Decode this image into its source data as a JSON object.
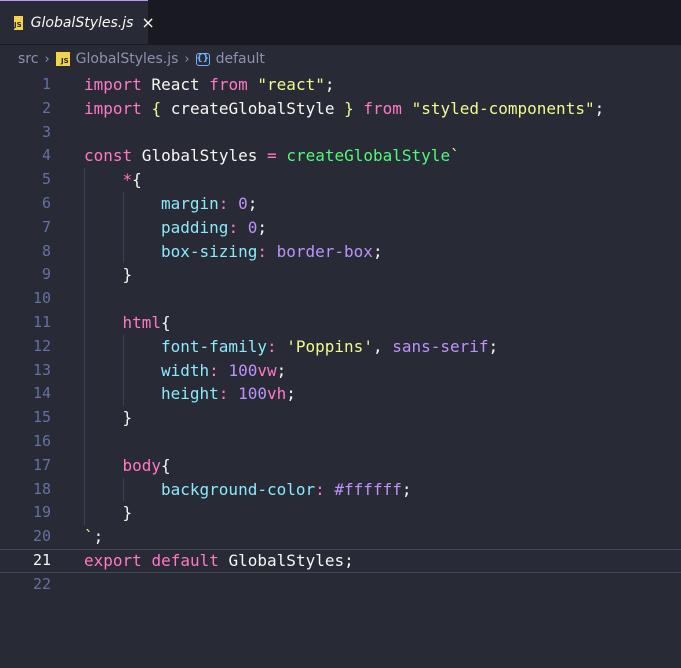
{
  "tab": {
    "title": "GlobalStyles.js",
    "icon": "js-file-icon",
    "close": "×"
  },
  "breadcrumb": {
    "folder": "src",
    "file": "GlobalStyles.js",
    "symbol": "default"
  },
  "colors": {
    "background": "#282a36",
    "tabbar": "#191a21",
    "keyword": "#ff79c6",
    "string": "#f1fa8c",
    "function": "#50fa7b",
    "property": "#8be9fd",
    "number": "#bd93f9"
  },
  "editor": {
    "active_line": 21,
    "lines": [
      {
        "n": "1",
        "indent": 0,
        "tokens": [
          [
            "kw",
            "import"
          ],
          [
            "plain",
            " React "
          ],
          [
            "kw",
            "from"
          ],
          [
            "plain",
            " "
          ],
          [
            "str",
            "\"react\""
          ],
          [
            "plain",
            ";"
          ]
        ]
      },
      {
        "n": "2",
        "indent": 0,
        "tokens": [
          [
            "kw",
            "import"
          ],
          [
            "plain",
            " "
          ],
          [
            "brace",
            "{"
          ],
          [
            "plain",
            " createGlobalStyle "
          ],
          [
            "brace",
            "}"
          ],
          [
            "plain",
            " "
          ],
          [
            "kw",
            "from"
          ],
          [
            "plain",
            " "
          ],
          [
            "str",
            "\"styled-components\""
          ],
          [
            "plain",
            ";"
          ]
        ]
      },
      {
        "n": "3",
        "indent": 0,
        "tokens": []
      },
      {
        "n": "4",
        "indent": 0,
        "tokens": [
          [
            "kw",
            "const"
          ],
          [
            "plain",
            " GlobalStyles "
          ],
          [
            "op",
            "="
          ],
          [
            "plain",
            " "
          ],
          [
            "fn",
            "createGlobalStyle"
          ],
          [
            "str",
            "`"
          ]
        ]
      },
      {
        "n": "5",
        "indent": 1,
        "tokens": [
          [
            "tag",
            "*"
          ],
          [
            "plain",
            "{"
          ]
        ]
      },
      {
        "n": "6",
        "indent": 2,
        "tokens": [
          [
            "prop",
            "margin"
          ],
          [
            "op",
            ":"
          ],
          [
            "plain",
            " "
          ],
          [
            "num",
            "0"
          ],
          [
            "plain",
            ";"
          ]
        ]
      },
      {
        "n": "7",
        "indent": 2,
        "tokens": [
          [
            "prop",
            "padding"
          ],
          [
            "op",
            ":"
          ],
          [
            "plain",
            " "
          ],
          [
            "num",
            "0"
          ],
          [
            "plain",
            ";"
          ]
        ]
      },
      {
        "n": "8",
        "indent": 2,
        "tokens": [
          [
            "prop",
            "box-sizing"
          ],
          [
            "op",
            ":"
          ],
          [
            "plain",
            " "
          ],
          [
            "val",
            "border-box"
          ],
          [
            "plain",
            ";"
          ]
        ]
      },
      {
        "n": "9",
        "indent": 1,
        "tokens": [
          [
            "plain",
            "}"
          ]
        ]
      },
      {
        "n": "10",
        "indent": 1,
        "tokens": []
      },
      {
        "n": "11",
        "indent": 1,
        "tokens": [
          [
            "tag",
            "html"
          ],
          [
            "plain",
            "{"
          ]
        ]
      },
      {
        "n": "12",
        "indent": 2,
        "tokens": [
          [
            "prop",
            "font-family"
          ],
          [
            "op",
            ":"
          ],
          [
            "plain",
            " "
          ],
          [
            "str",
            "'Poppins'"
          ],
          [
            "plain",
            ", "
          ],
          [
            "val",
            "sans-serif"
          ],
          [
            "plain",
            ";"
          ]
        ]
      },
      {
        "n": "13",
        "indent": 2,
        "tokens": [
          [
            "prop",
            "width"
          ],
          [
            "op",
            ":"
          ],
          [
            "plain",
            " "
          ],
          [
            "num",
            "100"
          ],
          [
            "unit",
            "vw"
          ],
          [
            "plain",
            ";"
          ]
        ]
      },
      {
        "n": "14",
        "indent": 2,
        "tokens": [
          [
            "prop",
            "height"
          ],
          [
            "op",
            ":"
          ],
          [
            "plain",
            " "
          ],
          [
            "num",
            "100"
          ],
          [
            "unit",
            "vh"
          ],
          [
            "plain",
            ";"
          ]
        ]
      },
      {
        "n": "15",
        "indent": 1,
        "tokens": [
          [
            "plain",
            "}"
          ]
        ]
      },
      {
        "n": "16",
        "indent": 1,
        "tokens": []
      },
      {
        "n": "17",
        "indent": 1,
        "tokens": [
          [
            "tag",
            "body"
          ],
          [
            "plain",
            "{"
          ]
        ]
      },
      {
        "n": "18",
        "indent": 2,
        "tokens": [
          [
            "prop",
            "background-color"
          ],
          [
            "op",
            ":"
          ],
          [
            "plain",
            " "
          ],
          [
            "val",
            "#ffffff"
          ],
          [
            "plain",
            ";"
          ]
        ]
      },
      {
        "n": "19",
        "indent": 1,
        "tokens": [
          [
            "plain",
            "}"
          ]
        ]
      },
      {
        "n": "20",
        "indent": 0,
        "tokens": [
          [
            "str",
            "`"
          ],
          [
            "plain",
            ";"
          ]
        ]
      },
      {
        "n": "21",
        "indent": 0,
        "tokens": [
          [
            "kw",
            "export"
          ],
          [
            "plain",
            " "
          ],
          [
            "kw",
            "default"
          ],
          [
            "plain",
            " GlobalStyles;"
          ]
        ]
      },
      {
        "n": "22",
        "indent": 0,
        "tokens": []
      }
    ]
  }
}
